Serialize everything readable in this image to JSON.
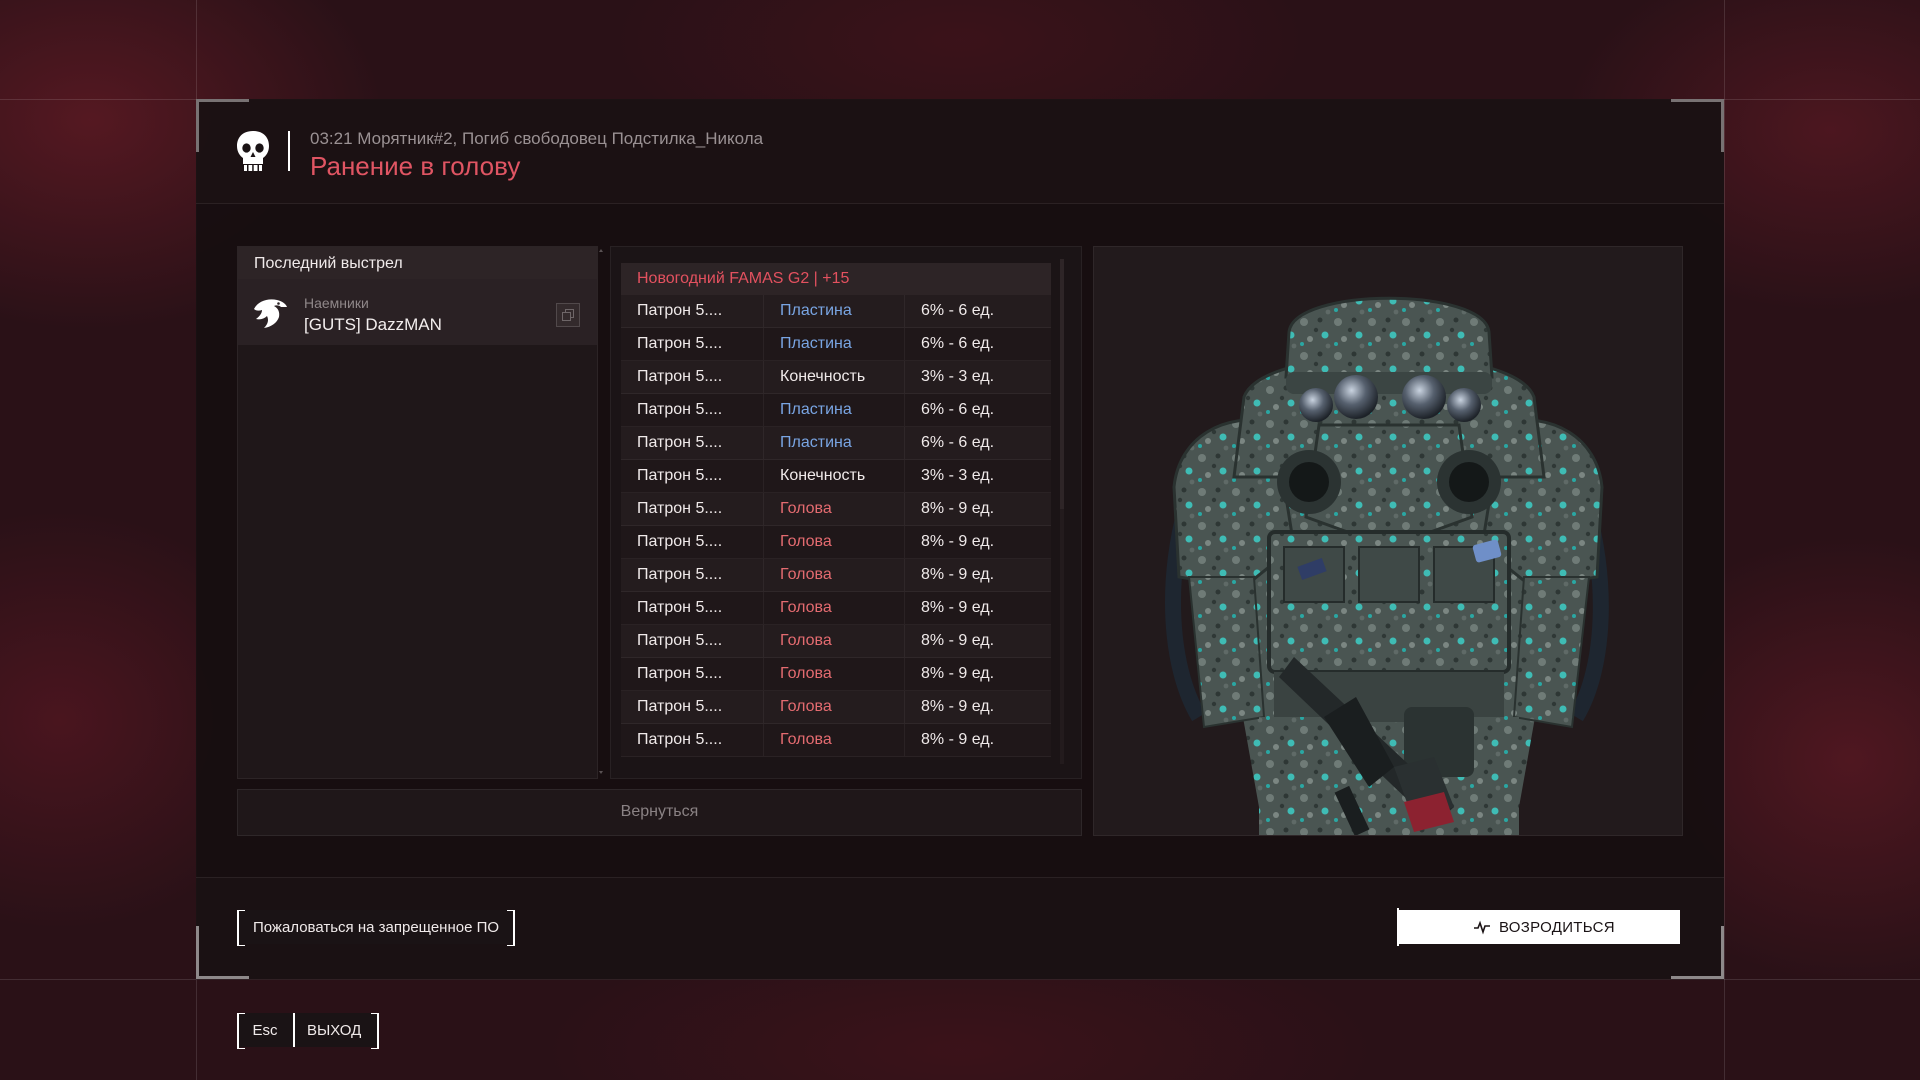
{
  "death": {
    "subtitle": "03:21 Морятник#2, Погиб свободовец Подстилка_Никола",
    "cause": "Ранение в голову"
  },
  "last_shot": {
    "title": "Последний выстрел",
    "faction": "Наемники",
    "player": "[GUTS] DazzMAN"
  },
  "weapon": {
    "name": "Новогодний FAMAS G2  |  +15"
  },
  "hits": [
    {
      "ammo": "Патрон 5....",
      "zone": "Пластина",
      "damage": "6% - 6 ед."
    },
    {
      "ammo": "Патрон 5....",
      "zone": "Пластина",
      "damage": "6% - 6 ед."
    },
    {
      "ammo": "Патрон 5....",
      "zone": "Конечность",
      "damage": "3% - 3 ед."
    },
    {
      "ammo": "Патрон 5....",
      "zone": "Пластина",
      "damage": "6% - 6 ед."
    },
    {
      "ammo": "Патрон 5....",
      "zone": "Пластина",
      "damage": "6% - 6 ед."
    },
    {
      "ammo": "Патрон 5....",
      "zone": "Конечность",
      "damage": "3% - 3 ед."
    },
    {
      "ammo": "Патрон 5....",
      "zone": "Голова",
      "damage": "8% - 9 ед."
    },
    {
      "ammo": "Патрон 5....",
      "zone": "Голова",
      "damage": "8% - 9 ед."
    },
    {
      "ammo": "Патрон 5....",
      "zone": "Голова",
      "damage": "8% - 9 ед."
    },
    {
      "ammo": "Патрон 5....",
      "zone": "Голова",
      "damage": "8% - 9 ед."
    },
    {
      "ammo": "Патрон 5....",
      "zone": "Голова",
      "damage": "8% - 9 ед."
    },
    {
      "ammo": "Патрон 5....",
      "zone": "Голова",
      "damage": "8% - 9 ед."
    },
    {
      "ammo": "Патрон 5....",
      "zone": "Голова",
      "damage": "8% - 9 ед."
    },
    {
      "ammo": "Патрон 5....",
      "zone": "Голова",
      "damage": "8% - 9 ед."
    }
  ],
  "zone_colors": {
    "Пластина": "#79a5e3",
    "Конечность": "#f0eaea",
    "Голова": "#e46b70"
  },
  "buttons": {
    "back": "Вернуться",
    "report": "Пожаловаться на запрещенное ПО",
    "respawn": "ВОЗРОДИТЬСЯ",
    "esc_key": "Esc",
    "exit": "ВЫХОД"
  },
  "icons": {
    "death": "skull-icon",
    "faction": "eagle-icon",
    "copy": "copy-icon",
    "respawn": "pulse-icon"
  },
  "colors": {
    "accent_red": "#e05563",
    "panel": "#1f1719",
    "text": "#f0eaea"
  }
}
